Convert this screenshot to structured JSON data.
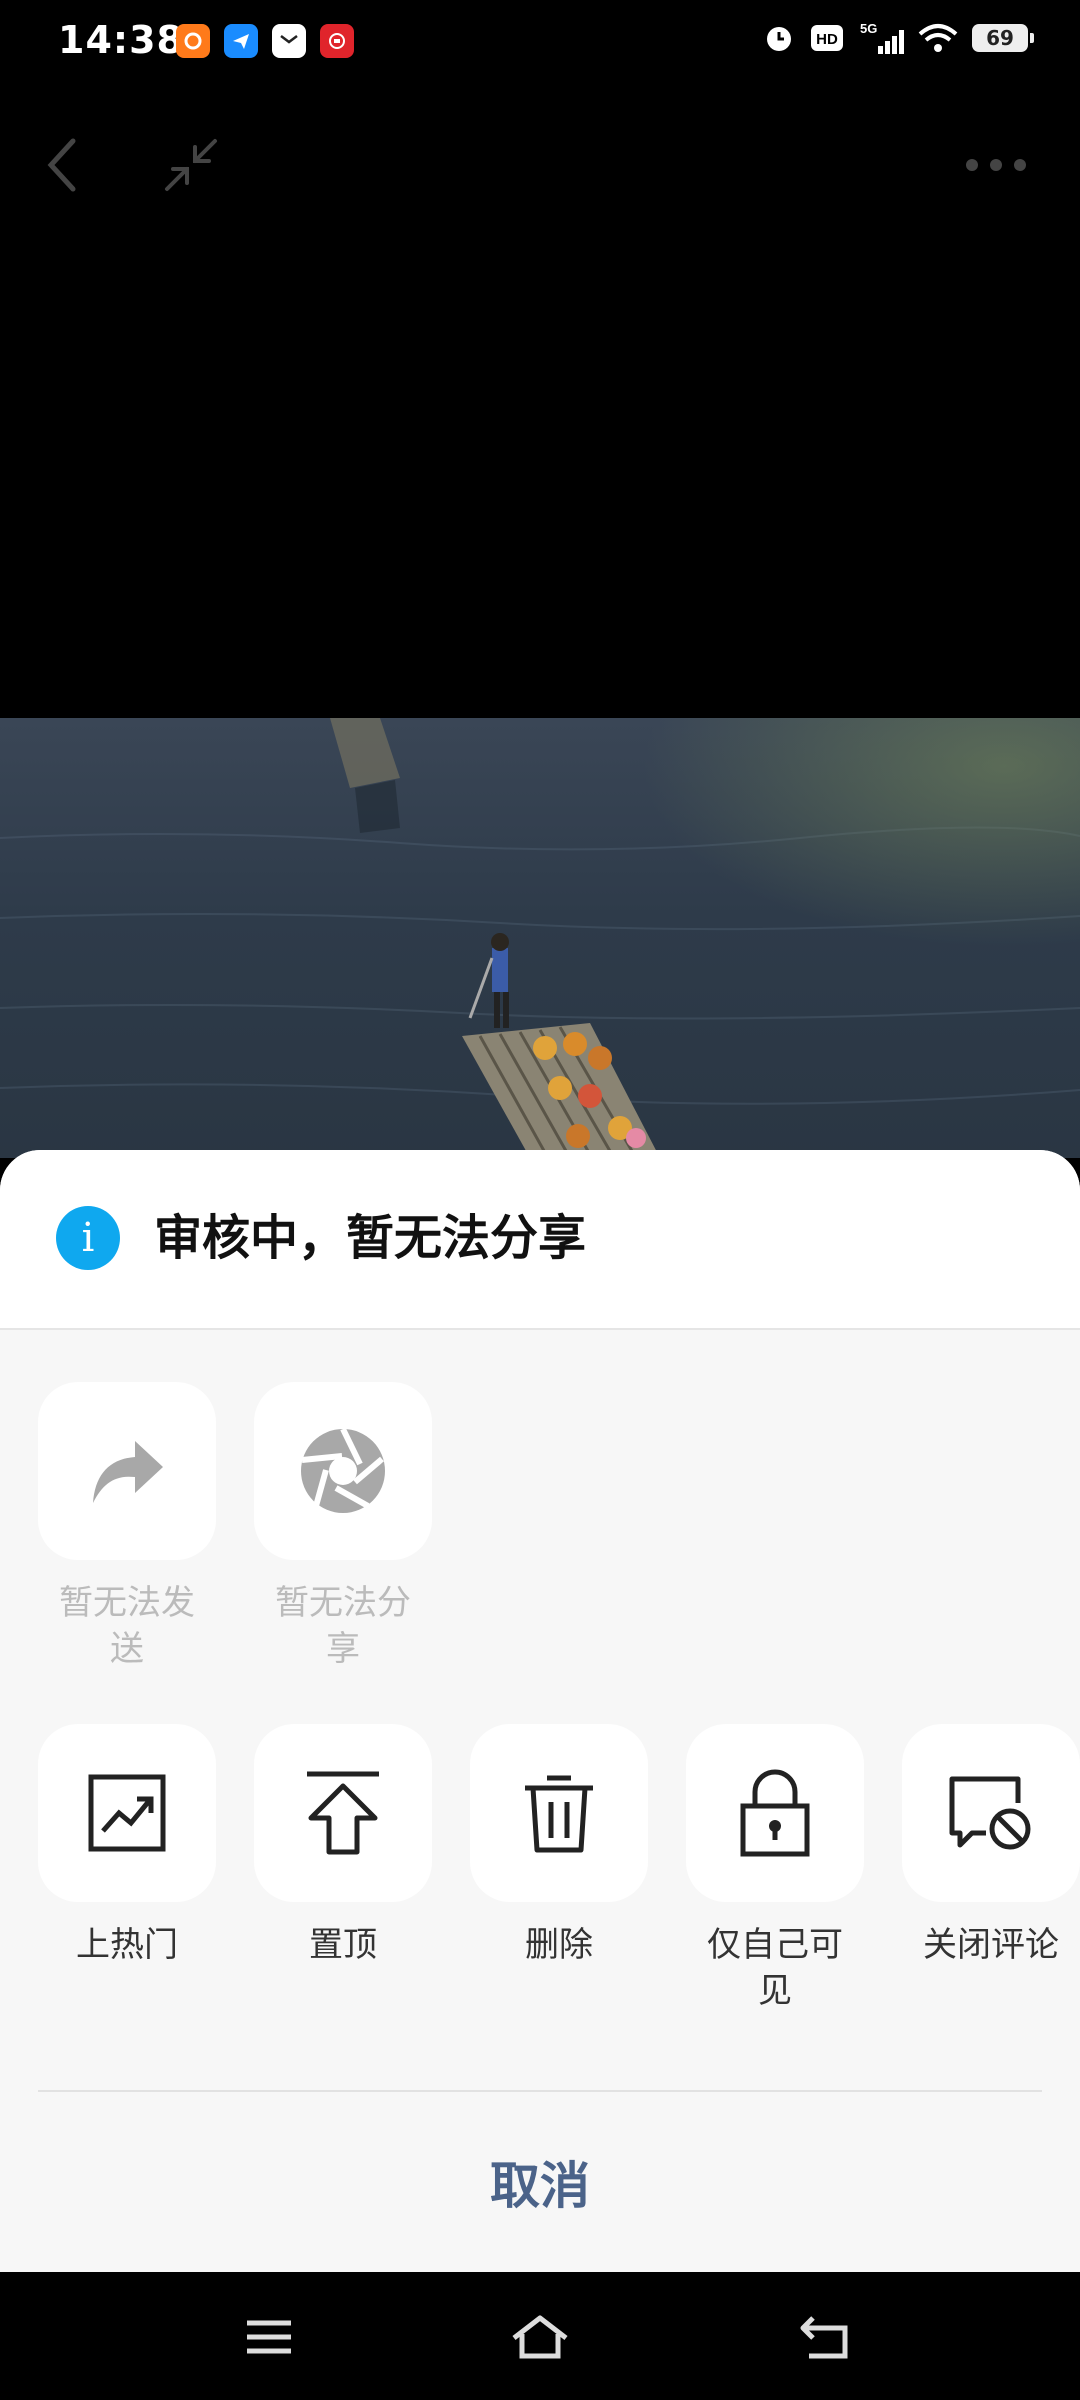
{
  "status_bar": {
    "time": "14:38",
    "battery": "69",
    "network": "5G",
    "icons": [
      "app-orange-icon",
      "app-blue-icon",
      "app-mail-icon",
      "app-red-icon",
      "alarm-icon",
      "hd-icon",
      "signal-icon",
      "wifi-icon",
      "battery-icon"
    ]
  },
  "video_controls": {
    "icons": [
      "back-chevron-icon",
      "minimize-icon",
      "more-dots-icon"
    ]
  },
  "sheet": {
    "title": "审核中，暂无法分享",
    "share_actions": [
      {
        "label": "暂无法发\n送",
        "icon": "forward-arrow-icon",
        "disabled": true
      },
      {
        "label": "暂无法分\n享",
        "icon": "shutter-icon",
        "disabled": true
      }
    ],
    "manage_actions": [
      {
        "label": "上热门",
        "icon": "trending-chart-icon"
      },
      {
        "label": "置顶",
        "icon": "pin-top-icon"
      },
      {
        "label": "删除",
        "icon": "trash-icon"
      },
      {
        "label": "仅自己可\n见",
        "icon": "lock-icon"
      },
      {
        "label": "关闭评论",
        "icon": "comment-off-icon"
      }
    ],
    "cancel": "取消"
  },
  "nav_bar": {
    "icons": [
      "menu-icon",
      "home-icon",
      "back-icon"
    ]
  },
  "colors": {
    "info_blue": "#0fa8ef",
    "cancel_text": "#4b6389",
    "sheet_bg": "#f7f7f7",
    "disabled_text": "#bbbbbb"
  }
}
